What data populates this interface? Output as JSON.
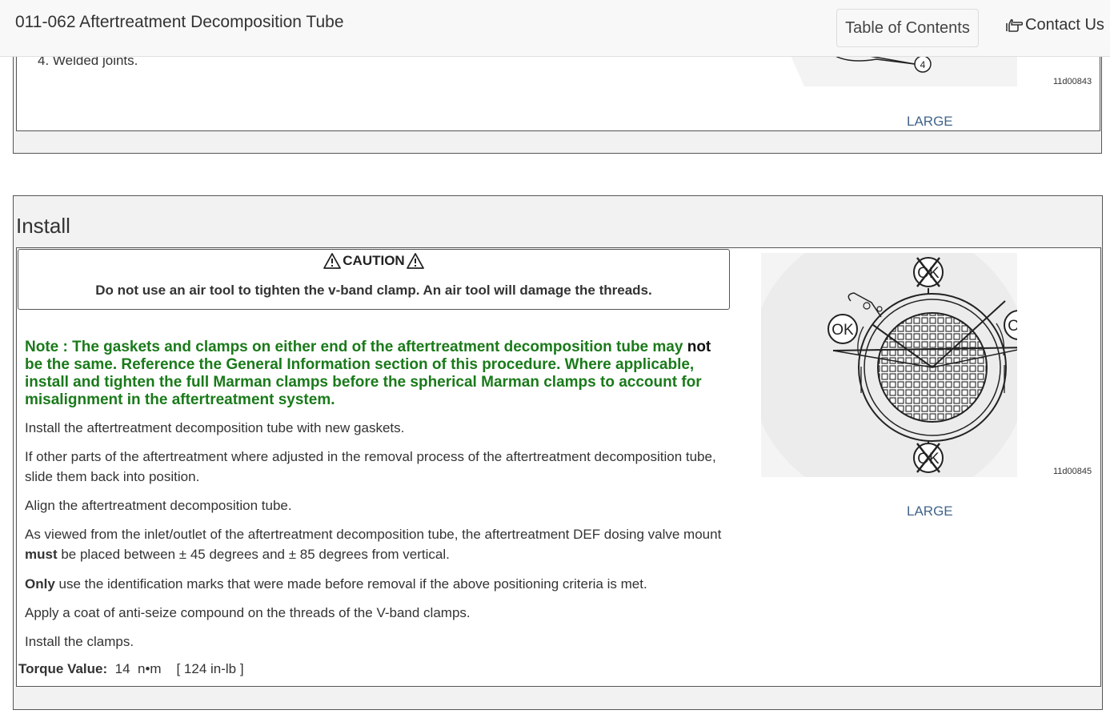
{
  "header": {
    "title": "011-062 Aftertreatment Decomposition Tube",
    "toc_label": "Table of Contents",
    "contact_label": "Contact Us"
  },
  "previous_section": {
    "list_item": "4. Welded joints.",
    "callout_number": "4",
    "figure_id": "11d00843",
    "large_link": "LARGE"
  },
  "install": {
    "heading": "Install",
    "caution": {
      "title": "CAUTION",
      "text": "Do not use an air tool to tighten the v-band clamp. An air tool will damage the threads."
    },
    "note": {
      "label": "Note :",
      "text_1": " The gaskets and clamps on either end of the aftertreatment decomposition tube may ",
      "emph": "not",
      "text_2": " be the same. Reference the General Information section of this procedure.  Where applicable, install and tighten the full Marman clamps before the spherical Marman clamps to account for misalignment in the aftertreatment system."
    },
    "steps": {
      "s1": "Install the aftertreatment decomposition tube with new gaskets.",
      "s2": "If other parts of the aftertreatment where adjusted in the removal process of the aftertreatment decomposition tube, slide them back into position.",
      "s3": "Align the aftertreatment decomposition tube.",
      "s4_a": "As viewed from the inlet/outlet of the aftertreatment decomposition tube, the aftertreatment DEF dosing valve mount ",
      "s4_b": "must",
      "s4_c": " be placed between ± 45 degrees and ± 85 degrees from vertical.",
      "s5_a": "Only",
      "s5_b": " use the identification marks that were made before removal if the above positioning criteria is met.",
      "s6": "Apply a coat of anti-seize compound on the threads of the V-band clamps.",
      "s7": "Install the clamps."
    },
    "torque": {
      "label": "Torque Value:",
      "value": "14",
      "unit": "n•m",
      "alt": "[ 124 in-lb ]"
    },
    "figure": {
      "ok_label": "OK",
      "figure_id": "11d00845",
      "large_link": "LARGE"
    }
  }
}
